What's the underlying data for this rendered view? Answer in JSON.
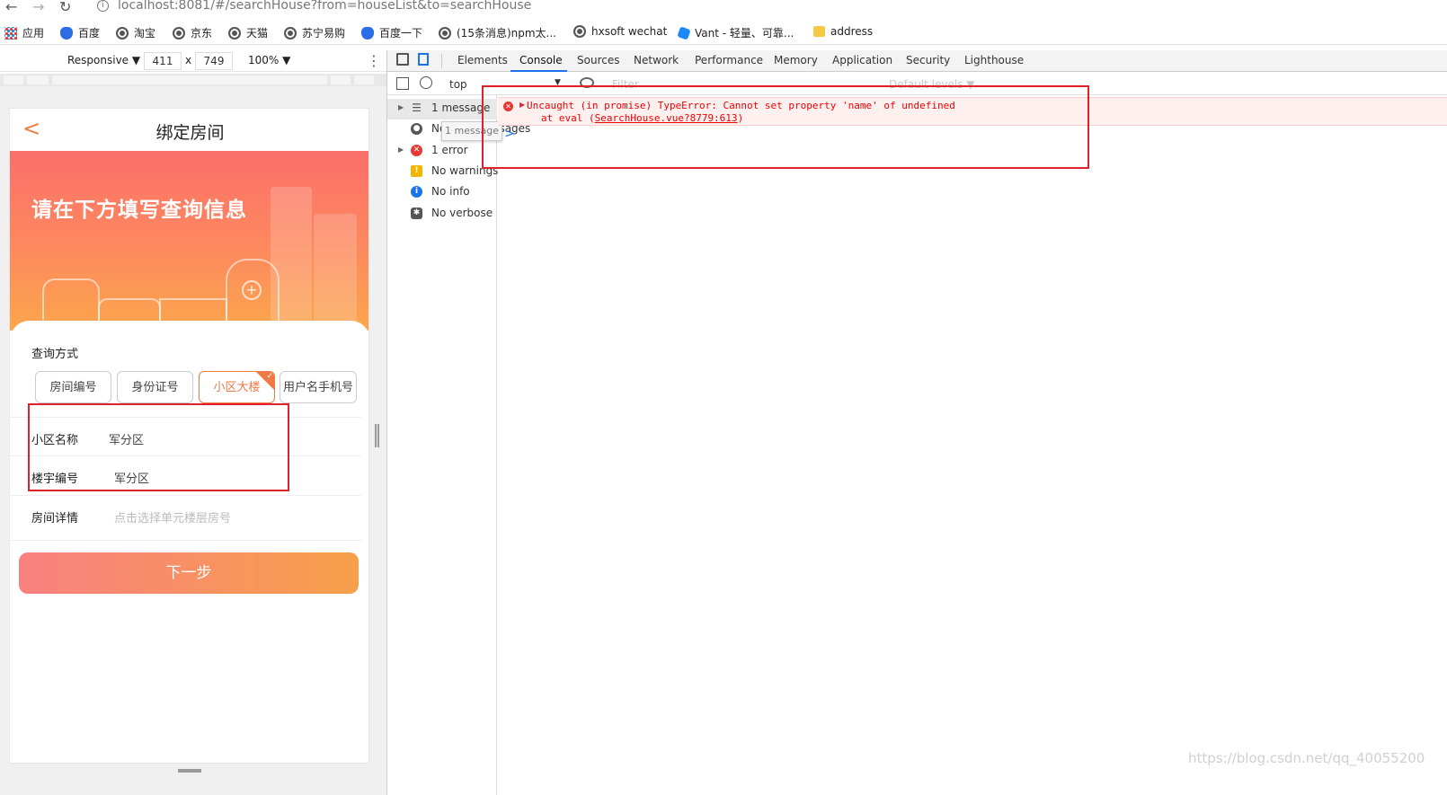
{
  "browser": {
    "url": "localhost:8081/#/searchHouse?from=houseList&to=searchHouse",
    "bookmarks": [
      "应用",
      "百度",
      "淘宝",
      "京东",
      "天猫",
      "苏宁易购",
      "百度一下",
      "(15条消息)npm太...",
      "hxsoft wechat",
      "Vant - 轻量、可靠...",
      "address"
    ]
  },
  "device_toolbar": {
    "mode": "Responsive ▼",
    "width": "411",
    "times": "x",
    "height": "749",
    "zoom": "100% ▼"
  },
  "phone": {
    "back_glyph": "<",
    "title": "绑定房间",
    "banner_text": "请在下方填写查询信息",
    "query_label": "查询方式",
    "options": [
      "房间编号",
      "身份证号",
      "小区大楼",
      "用户名手机号"
    ],
    "active_option": "小区大楼",
    "fields": [
      {
        "label": "小区名称",
        "value": "军分区"
      },
      {
        "label": "楼宇编号",
        "value": "军分区"
      },
      {
        "label": "房间详情",
        "placeholder": "点击选择单元楼层房号"
      }
    ],
    "next_button": "下一步"
  },
  "devtools": {
    "tabs": [
      "Elements",
      "Console",
      "Sources",
      "Network",
      "Performance",
      "Memory",
      "Application",
      "Security",
      "Lighthouse"
    ],
    "active_tab": "Console",
    "context": "top",
    "filter_placeholder": "Filter",
    "levels": "Default levels ▼",
    "sidebar": [
      {
        "icon": "list-icon",
        "text": "1 message",
        "expandable": true
      },
      {
        "icon": "user-icon",
        "text": "No user messages",
        "expandable": false
      },
      {
        "icon": "error-icon",
        "text": "1 error",
        "expandable": true
      },
      {
        "icon": "warning-icon",
        "text": "No warnings",
        "expandable": false
      },
      {
        "icon": "info-icon",
        "text": "No info",
        "expandable": false
      },
      {
        "icon": "verbose-icon",
        "text": "No verbose",
        "expandable": false
      }
    ],
    "tooltip": "1 message",
    "error": {
      "message": "Uncaught (in promise) TypeError: Cannot set property 'name' of undefined",
      "stack_prefix": "at eval (",
      "stack_link": "SearchHouse.vue?8779:613",
      "stack_suffix": ")"
    },
    "prompt": ">"
  },
  "colors": {
    "accent": "#f07a45",
    "highlight_box": "#e0202a",
    "error_text": "#e00000",
    "devtools_blue": "#1a73e8"
  },
  "watermark": "https://blog.csdn.net/qq_40055200"
}
